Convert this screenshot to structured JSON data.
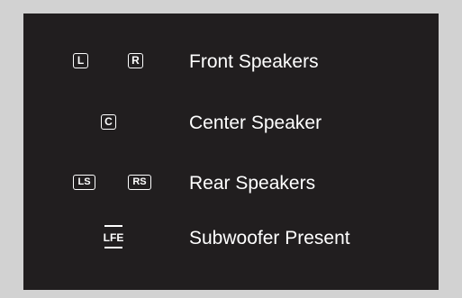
{
  "panel": {
    "background": "#211e1f",
    "outer_background": "#d2d2d2",
    "text_color": "#ffffff"
  },
  "rows": {
    "front": {
      "icons": [
        "L",
        "R"
      ],
      "label": "Front Speakers"
    },
    "center": {
      "icons": [
        "C"
      ],
      "label": "Center Speaker"
    },
    "rear": {
      "icons": [
        "LS",
        "RS"
      ],
      "label": "Rear Speakers"
    },
    "subwoofer": {
      "icon": "LFE",
      "label": "Subwoofer Present"
    }
  }
}
